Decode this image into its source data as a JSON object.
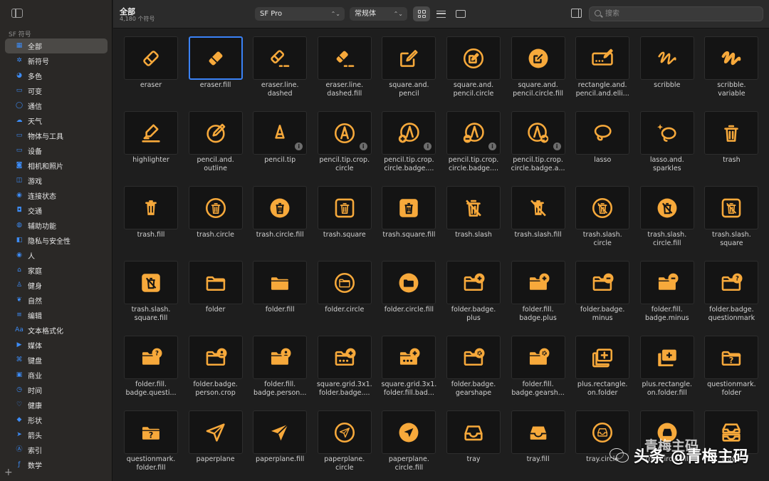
{
  "sidebar": {
    "section": "SF 符号",
    "items": [
      {
        "label": "全部",
        "icon": "square-grid-icon"
      },
      {
        "label": "新符号",
        "icon": "sparkle-icon"
      },
      {
        "label": "多色",
        "icon": "paintpalette-icon"
      },
      {
        "label": "可变",
        "icon": "variable-icon"
      },
      {
        "label": "通信",
        "icon": "message-icon"
      },
      {
        "label": "天气",
        "icon": "cloud-icon"
      },
      {
        "label": "物体与工具",
        "icon": "folder-icon"
      },
      {
        "label": "设备",
        "icon": "display-icon"
      },
      {
        "label": "相机和照片",
        "icon": "photo-icon"
      },
      {
        "label": "游戏",
        "icon": "gamecontroller-icon"
      },
      {
        "label": "连接状态",
        "icon": "antenna-icon"
      },
      {
        "label": "交通",
        "icon": "car-icon"
      },
      {
        "label": "辅助功能",
        "icon": "accessibility-icon"
      },
      {
        "label": "隐私与安全性",
        "icon": "lock-icon"
      },
      {
        "label": "人",
        "icon": "person-icon"
      },
      {
        "label": "家庭",
        "icon": "house-icon"
      },
      {
        "label": "健身",
        "icon": "figure-run-icon"
      },
      {
        "label": "自然",
        "icon": "leaf-icon"
      },
      {
        "label": "编辑",
        "icon": "slider-icon"
      },
      {
        "label": "文本格式化",
        "icon": "textformat-icon"
      },
      {
        "label": "媒体",
        "icon": "playpause-icon"
      },
      {
        "label": "键盘",
        "icon": "command-icon"
      },
      {
        "label": "商业",
        "icon": "cart-icon"
      },
      {
        "label": "时间",
        "icon": "clock-icon"
      },
      {
        "label": "健康",
        "icon": "heart-icon"
      },
      {
        "label": "形状",
        "icon": "shapes-icon"
      },
      {
        "label": "箭头",
        "icon": "arrow-icon"
      },
      {
        "label": "索引",
        "icon": "a-circle-icon"
      },
      {
        "label": "数学",
        "icon": "function-icon"
      }
    ],
    "add_label": "+"
  },
  "toolbar": {
    "title": "全部",
    "subtitle": "4,180 个符号",
    "font_select": "SF Pro",
    "weight_select": "常规体",
    "search_placeholder": "搜索"
  },
  "accent": "#F7A93B",
  "symbols": [
    {
      "name": "eraser",
      "glyph": "eraser"
    },
    {
      "name": "eraser.fill",
      "glyph": "eraser-fill",
      "selected": true
    },
    {
      "name": "eraser.line.\ndashed",
      "glyph": "eraser-dashed"
    },
    {
      "name": "eraser.line.\ndashed.fill",
      "glyph": "eraser-dashed-fill"
    },
    {
      "name": "square.and.\npencil",
      "glyph": "square-pencil"
    },
    {
      "name": "square.and.\npencil.circle",
      "glyph": "square-pencil-circle"
    },
    {
      "name": "square.and.\npencil.circle.fill",
      "glyph": "square-pencil-circle-fill"
    },
    {
      "name": "rectangle.and.\npencil.and.elli...",
      "glyph": "rect-pencil"
    },
    {
      "name": "scribble",
      "glyph": "scribble"
    },
    {
      "name": "scribble.\nvariable",
      "glyph": "scribble-variable"
    },
    {
      "name": "highlighter",
      "glyph": "highlighter"
    },
    {
      "name": "pencil.and.\noutline",
      "glyph": "pencil-outline"
    },
    {
      "name": "pencil.tip",
      "glyph": "pencil-tip",
      "info": true
    },
    {
      "name": "pencil.tip.crop.\ncircle",
      "glyph": "pencil-tip-circle",
      "info": true
    },
    {
      "name": "pencil.tip.crop.\ncircle.badge....",
      "glyph": "pencil-tip-circle-plus",
      "info": true
    },
    {
      "name": "pencil.tip.crop.\ncircle.badge....",
      "glyph": "pencil-tip-circle-minus",
      "info": true
    },
    {
      "name": "pencil.tip.crop.\ncircle.badge.a...",
      "glyph": "pencil-tip-circle-arrow",
      "info": true
    },
    {
      "name": "lasso",
      "glyph": "lasso"
    },
    {
      "name": "lasso.and.\nsparkles",
      "glyph": "lasso-sparkles"
    },
    {
      "name": "trash",
      "glyph": "trash"
    },
    {
      "name": "trash.fill",
      "glyph": "trash-fill"
    },
    {
      "name": "trash.circle",
      "glyph": "trash-circle"
    },
    {
      "name": "trash.circle.fill",
      "glyph": "trash-circle-fill"
    },
    {
      "name": "trash.square",
      "glyph": "trash-square"
    },
    {
      "name": "trash.square.fill",
      "glyph": "trash-square-fill"
    },
    {
      "name": "trash.slash",
      "glyph": "trash-slash"
    },
    {
      "name": "trash.slash.fill",
      "glyph": "trash-slash-fill"
    },
    {
      "name": "trash.slash.\ncircle",
      "glyph": "trash-slash-circle"
    },
    {
      "name": "trash.slash.\ncircle.fill",
      "glyph": "trash-slash-circle-fill"
    },
    {
      "name": "trash.slash.\nsquare",
      "glyph": "trash-slash-square"
    },
    {
      "name": "trash.slash.\nsquare.fill",
      "glyph": "trash-slash-square-fill"
    },
    {
      "name": "folder",
      "glyph": "folder"
    },
    {
      "name": "folder.fill",
      "glyph": "folder-fill"
    },
    {
      "name": "folder.circle",
      "glyph": "folder-circle"
    },
    {
      "name": "folder.circle.fill",
      "glyph": "folder-circle-fill"
    },
    {
      "name": "folder.badge.\nplus",
      "glyph": "folder-plus"
    },
    {
      "name": "folder.fill.\nbadge.plus",
      "glyph": "folder-fill-plus"
    },
    {
      "name": "folder.badge.\nminus",
      "glyph": "folder-minus"
    },
    {
      "name": "folder.fill.\nbadge.minus",
      "glyph": "folder-fill-minus"
    },
    {
      "name": "folder.badge.\nquestionmark",
      "glyph": "folder-question"
    },
    {
      "name": "folder.fill.\nbadge.questi...",
      "glyph": "folder-fill-question"
    },
    {
      "name": "folder.badge.\nperson.crop",
      "glyph": "folder-person"
    },
    {
      "name": "folder.fill.\nbadge.person...",
      "glyph": "folder-fill-person"
    },
    {
      "name": "square.grid.3x1.\nfolder.badge....",
      "glyph": "grid-folder-plus"
    },
    {
      "name": "square.grid.3x1.\nfolder.fill.bad...",
      "glyph": "grid-folder-fill-plus"
    },
    {
      "name": "folder.badge.\ngearshape",
      "glyph": "folder-gear"
    },
    {
      "name": "folder.fill.\nbadge.gearsh...",
      "glyph": "folder-fill-gear"
    },
    {
      "name": "plus.rectangle.\non.folder",
      "glyph": "plus-rect-folder"
    },
    {
      "name": "plus.rectangle.\non.folder.fill",
      "glyph": "plus-rect-folder-fill"
    },
    {
      "name": "questionmark.\nfolder",
      "glyph": "question-folder"
    },
    {
      "name": "questionmark.\nfolder.fill",
      "glyph": "question-folder-fill"
    },
    {
      "name": "paperplane",
      "glyph": "paperplane"
    },
    {
      "name": "paperplane.fill",
      "glyph": "paperplane-fill"
    },
    {
      "name": "paperplane.\ncircle",
      "glyph": "paperplane-circle"
    },
    {
      "name": "paperplane.\ncircle.fill",
      "glyph": "paperplane-circle-fill"
    },
    {
      "name": "tray",
      "glyph": "tray"
    },
    {
      "name": "tray.fill",
      "glyph": "tray-fill"
    },
    {
      "name": "tray.circle",
      "glyph": "tray-circle"
    },
    {
      "name": "tray.circle.fill",
      "glyph": "tray-circle-fill"
    },
    {
      "name": "tray.2",
      "glyph": "tray-2"
    }
  ],
  "watermark": {
    "main": "头条 @青梅主码",
    "top": "青梅主码"
  }
}
